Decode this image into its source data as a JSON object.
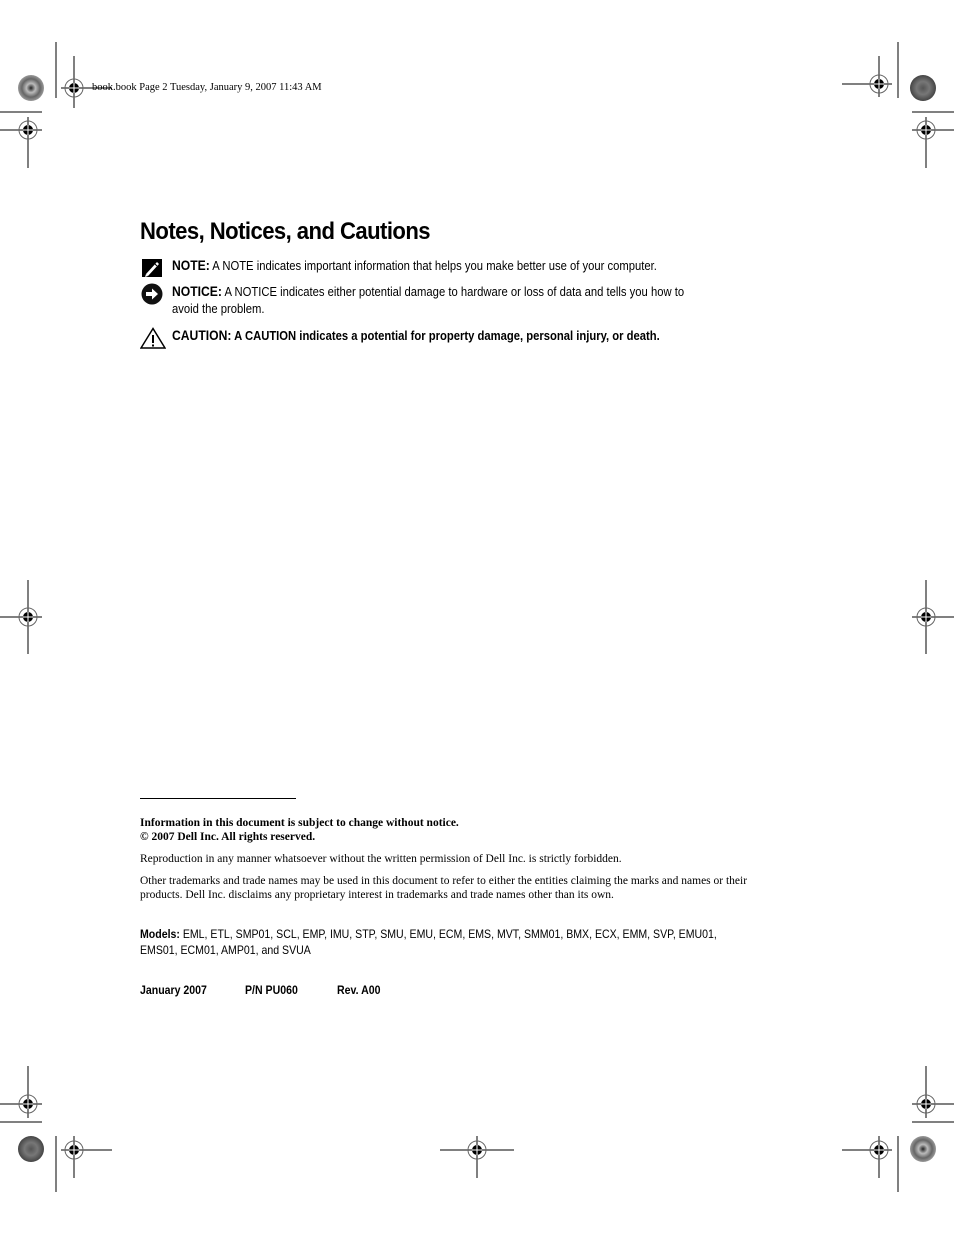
{
  "slug": "book.book  Page 2  Tuesday, January 9, 2007  11:43 AM",
  "page_title": "Notes, Notices, and Cautions",
  "admonitions": {
    "note": {
      "icon": "pencil-note-icon",
      "label": "NOTE:",
      "text": " A NOTE indicates important information that helps you make better use of your computer."
    },
    "notice": {
      "icon": "arrow-circle-notice-icon",
      "label": "NOTICE:",
      "text": " A NOTICE indicates either potential damage to hardware or loss of data and tells you how to avoid the problem."
    },
    "caution": {
      "icon": "warning-triangle-icon",
      "label": "CAUTION:",
      "text": " A CAUTION indicates a potential for property damage, personal injury, or death."
    }
  },
  "legal": {
    "line1": "Information in this document is subject to change without notice.",
    "line2": "© 2007 Dell Inc. All rights reserved.",
    "reproduction": "Reproduction in any manner whatsoever without the written permission of Dell Inc. is strictly forbidden.",
    "trademarks": "Other trademarks and trade names may be used in this document to refer to either the entities claiming the marks and names or their products. Dell Inc. disclaims any proprietary interest in trademarks and trade names other than its own."
  },
  "models": {
    "label": "Models:",
    "text": " EML, ETL, SMP01, SCL, EMP, IMU, STP, SMU, EMU, ECM, EMS, MVT, SMM01, BMX, ECX, EMM, SVP, EMU01, EMS01, ECM01, AMP01, and SVUA"
  },
  "footer": {
    "date": "January 2007",
    "part_number": "P/N PU060",
    "revision": "Rev. A00"
  }
}
